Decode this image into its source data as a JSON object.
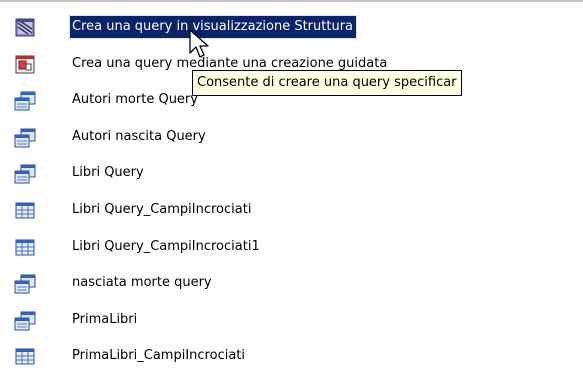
{
  "items": [
    {
      "label": "Crea una query in visualizzazione Struttura",
      "icon": "design-view-icon",
      "selected": true
    },
    {
      "label": "Crea una query mediante una creazione guidata",
      "icon": "wizard-icon"
    },
    {
      "label": "Autori morte Query",
      "icon": "select-query-icon"
    },
    {
      "label": "Autori nascita Query",
      "icon": "select-query-icon"
    },
    {
      "label": "Libri Query",
      "icon": "select-query-icon"
    },
    {
      "label": "Libri Query_CampiIncrociati",
      "icon": "crosstab-query-icon"
    },
    {
      "label": "Libri Query_CampiIncrociati1",
      "icon": "crosstab-query-icon"
    },
    {
      "label": "nasciata morte query",
      "icon": "select-query-icon"
    },
    {
      "label": "PrimaLibri",
      "icon": "select-query-icon"
    },
    {
      "label": "PrimaLibri_CampiIncrociati",
      "icon": "crosstab-query-icon"
    }
  ],
  "tooltip": {
    "text": "Consente di creare una query specificar"
  },
  "colors": {
    "selection": "#0a246a",
    "tooltip_bg": "#ffffe1"
  }
}
